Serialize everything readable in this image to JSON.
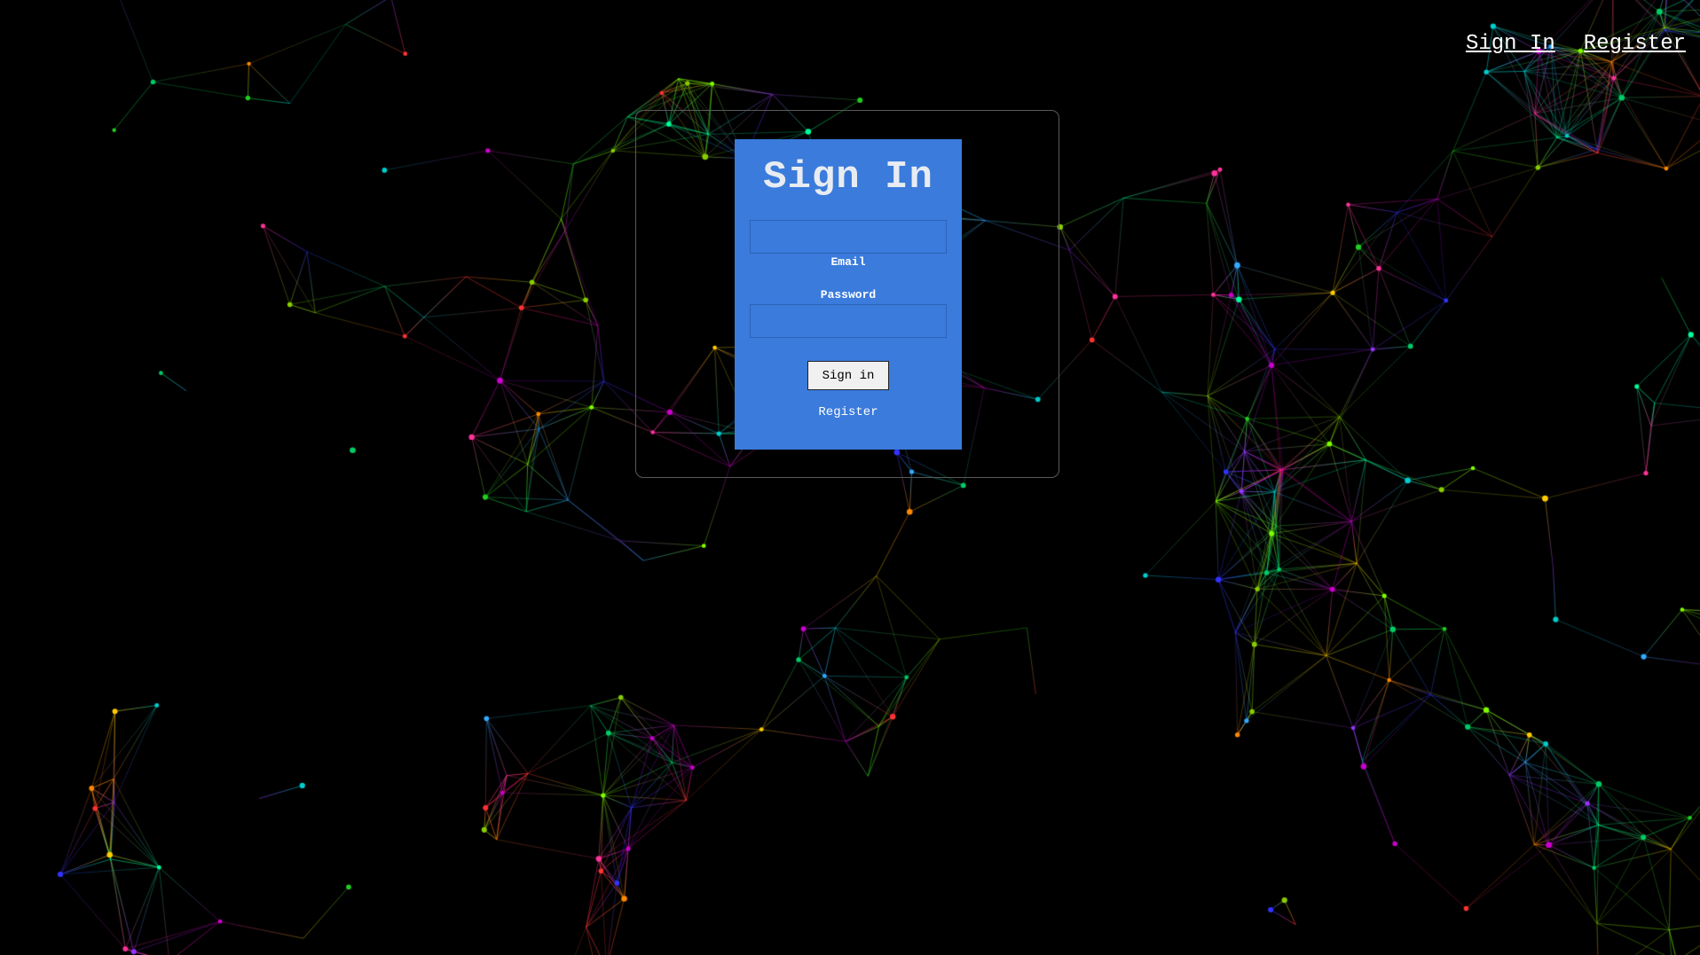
{
  "nav": {
    "signin_label": "Sign In",
    "register_label": "Register"
  },
  "form": {
    "title": "Sign In",
    "email_label": "Email",
    "email_value": "",
    "password_label": "Password",
    "password_value": "",
    "submit_label": "Sign in",
    "register_link": "Register"
  },
  "colors": {
    "background": "#000000",
    "card": "#3a7bdc",
    "frame_border": "#5a5a5a",
    "title": "#e8ecf2"
  }
}
